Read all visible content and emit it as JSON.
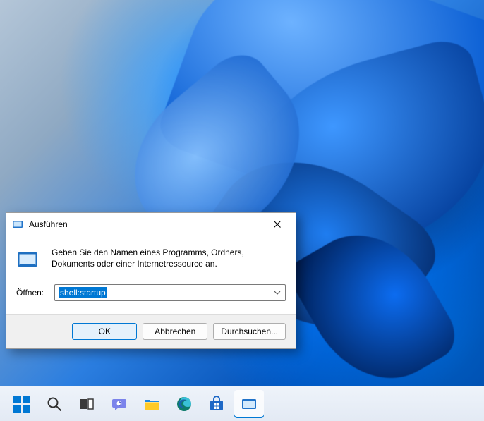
{
  "dialog": {
    "title": "Ausführen",
    "description": "Geben Sie den Namen eines Programms, Ordners, Dokuments oder einer Internetressource an.",
    "input_label": "Öffnen:",
    "input_value": "shell:startup",
    "buttons": {
      "ok": "OK",
      "cancel": "Abbrechen",
      "browse": "Durchsuchen..."
    }
  },
  "taskbar": {
    "items": [
      {
        "name": "start",
        "icon": "windows-start-icon"
      },
      {
        "name": "search",
        "icon": "search-icon"
      },
      {
        "name": "task-view",
        "icon": "task-view-icon"
      },
      {
        "name": "chat",
        "icon": "chat-icon"
      },
      {
        "name": "file-explorer",
        "icon": "folder-icon"
      },
      {
        "name": "edge",
        "icon": "edge-icon"
      },
      {
        "name": "store",
        "icon": "store-icon"
      },
      {
        "name": "run",
        "icon": "run-icon",
        "active": true
      }
    ]
  }
}
